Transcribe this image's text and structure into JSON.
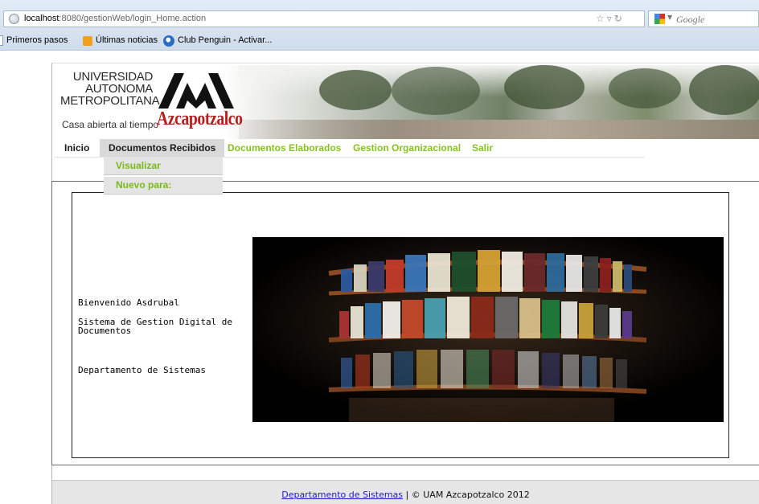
{
  "browser": {
    "url_host": "localhost",
    "url_rest": ":8080/gestionWeb/login_Home.action",
    "search_placeholder": "Google",
    "bookmarks": [
      "Primeros pasos",
      "Últimas noticias",
      "Club Penguin - Activar..."
    ]
  },
  "header": {
    "university_lines": [
      "UNIVERSIDAD",
      "AUTONOMA",
      "METROPOLITANA"
    ],
    "tagline": "Casa abierta al tiempo",
    "campus": "Azcapotzalco"
  },
  "nav": {
    "items": [
      "Inicio",
      "Documentos Recibidos",
      "Documentos Elaborados",
      "Gestion Organizacional",
      "Salir"
    ],
    "active_index": 1,
    "dropdown": [
      "Visualizar",
      "Nuevo para:"
    ]
  },
  "content": {
    "welcome": "Bienvenido Asdrubal",
    "system_line1": "Sistema de Gestion Digital de",
    "system_line2": "Documentos",
    "department": "Departamento de Sistemas"
  },
  "footer": {
    "link": "Departamento de Sistemas",
    "separator": " | ",
    "copyright": "© UAM Azcapotzalco 2012"
  },
  "colors": {
    "nav_green": "#86c21d",
    "campus_red": "#b91d1d",
    "footer_link": "#1a1ad0"
  }
}
